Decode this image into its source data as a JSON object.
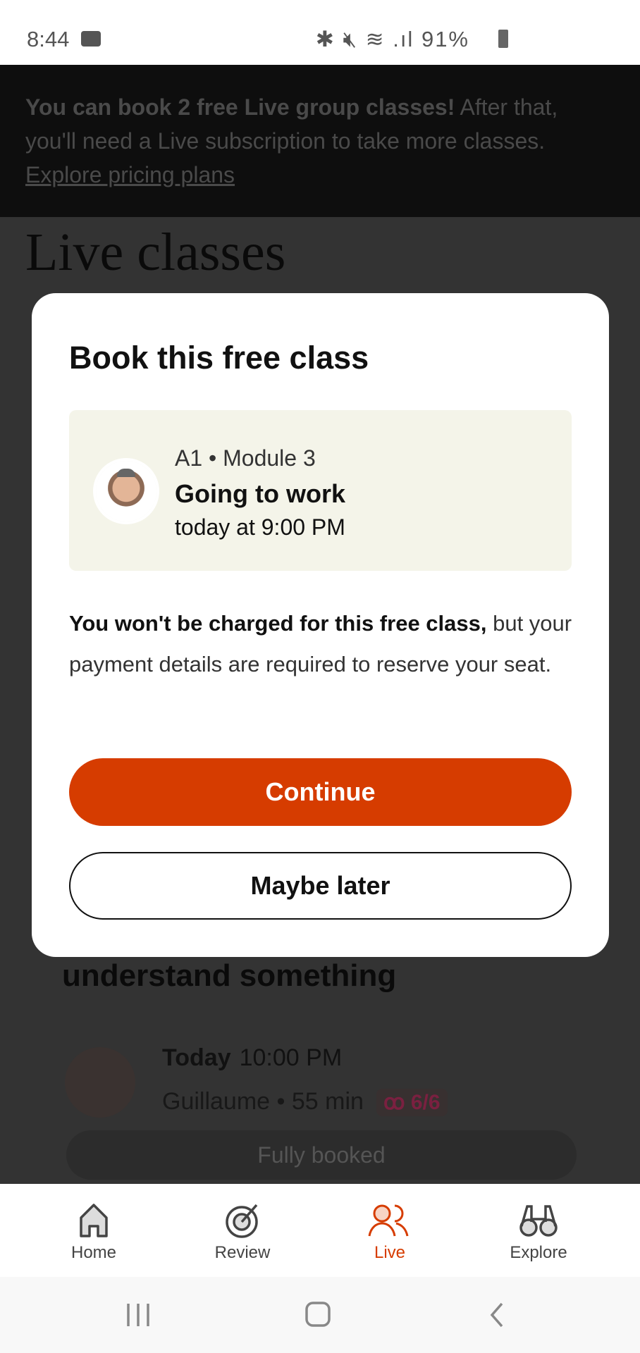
{
  "status_bar": {
    "time": "8:44",
    "battery": "91%",
    "icons": [
      "video-camera-icon",
      "bluetooth-icon",
      "mute-icon",
      "wifi-icon",
      "signal-icon",
      "battery-icon"
    ]
  },
  "banner": {
    "bold": "You can book 2 free Live group classes!",
    "text": " After that, you'll need a Live subscription to take more classes. ",
    "link": "Explore pricing plans"
  },
  "background": {
    "title": "Live classes",
    "heading": "understand something",
    "class": {
      "day": "Today",
      "time": "10:00 PM",
      "teacher": "Guillaume",
      "sep": "•",
      "duration": "55 min",
      "seats": "6/6",
      "button": "Fully booked"
    }
  },
  "dialog": {
    "title": "Book this free class",
    "class": {
      "level": "A1",
      "sep": "•",
      "module": "Module 3",
      "name": "Going to work",
      "when": "today at 9:00 PM"
    },
    "notice_bold": "You won't be charged for this free class,",
    "notice_text": " but your payment details are required to reserve your seat.",
    "continue_label": "Continue",
    "later_label": "Maybe later"
  },
  "nav": {
    "items": [
      {
        "label": "Home",
        "icon": "home-icon"
      },
      {
        "label": "Review",
        "icon": "target-icon"
      },
      {
        "label": "Live",
        "icon": "people-icon",
        "active": true
      },
      {
        "label": "Explore",
        "icon": "binoculars-icon"
      }
    ]
  },
  "colors": {
    "accent": "#d63c00",
    "card": "#f4f4e9"
  }
}
